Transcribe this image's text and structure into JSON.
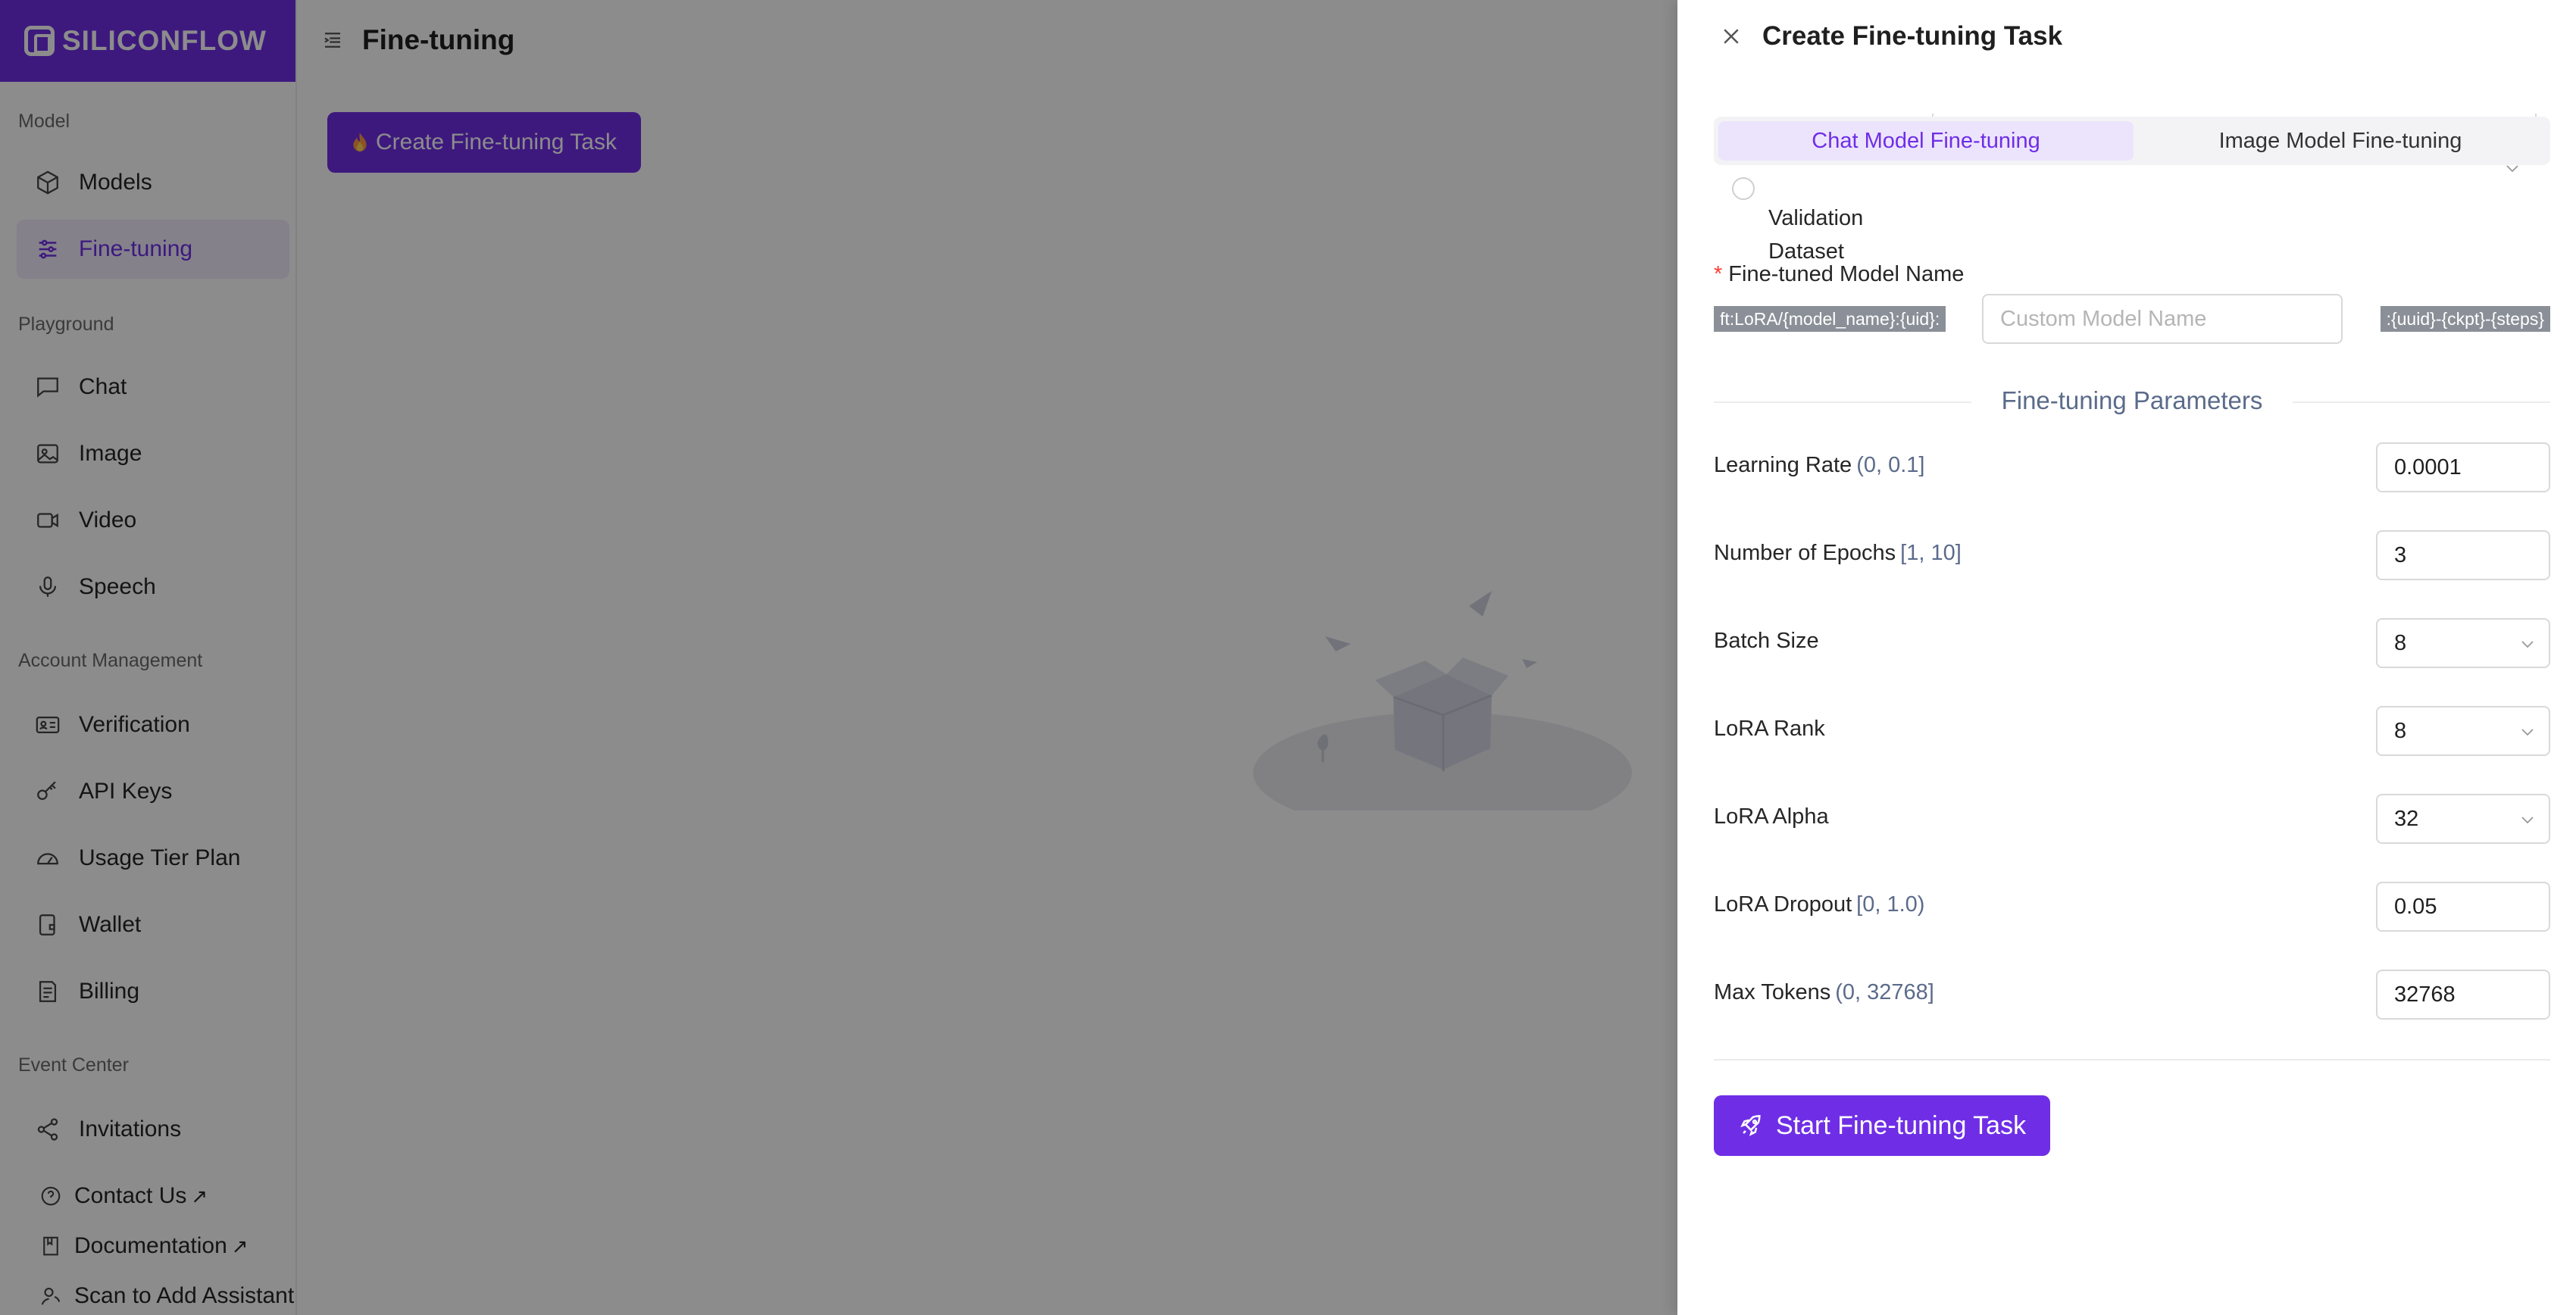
{
  "brand": {
    "name": "SILICONFLOW",
    "color": "#6f2ee6"
  },
  "sidebar": {
    "sections": [
      {
        "title": "Model",
        "items": [
          {
            "label": "Models",
            "icon": "cube-icon"
          },
          {
            "label": "Fine-tuning",
            "icon": "sliders-icon",
            "active": true
          }
        ]
      },
      {
        "title": "Playground",
        "items": [
          {
            "label": "Chat",
            "icon": "chat-icon"
          },
          {
            "label": "Image",
            "icon": "image-icon"
          },
          {
            "label": "Video",
            "icon": "video-icon"
          },
          {
            "label": "Speech",
            "icon": "microphone-icon"
          }
        ]
      },
      {
        "title": "Account Management",
        "items": [
          {
            "label": "Verification",
            "icon": "id-card-icon"
          },
          {
            "label": "API Keys",
            "icon": "key-icon"
          },
          {
            "label": "Usage Tier Plan",
            "icon": "speedometer-icon"
          },
          {
            "label": "Wallet",
            "icon": "wallet-icon"
          },
          {
            "label": "Billing",
            "icon": "bill-icon"
          }
        ]
      },
      {
        "title": "Event Center",
        "items": [
          {
            "label": "Invitations",
            "icon": "share-icon"
          }
        ]
      }
    ],
    "footer_links": [
      {
        "label": "Contact Us",
        "icon": "help-circle-icon",
        "external": "↗"
      },
      {
        "label": "Documentation",
        "icon": "book-icon",
        "external": "↗"
      },
      {
        "label": "Scan to Add Assistant",
        "icon": "user-icon"
      }
    ]
  },
  "main": {
    "title": "Fine-tuning",
    "create_button": "Create Fine-tuning Task"
  },
  "drawer": {
    "title": "Create Fine-tuning Task",
    "tabs": [
      {
        "label": "Chat Model Fine-tuning",
        "active": true
      },
      {
        "label": "Image Model Fine-tuning",
        "active": false
      }
    ],
    "validation_label": "Validation Dataset",
    "model_name": {
      "label": "Fine-tuned Model Name",
      "required_mark": "*",
      "prefix": "ft:LoRA/{model_name}:{uid}:",
      "placeholder": "Custom Model Name",
      "suffix": ":{uuid}-{ckpt}-{steps}"
    },
    "params_title": "Fine-tuning Parameters",
    "params": [
      {
        "label": "Learning Rate",
        "range": "(0, 0.1]",
        "value": "0.0001",
        "kind": "input"
      },
      {
        "label": "Number of Epochs",
        "range": "[1, 10]",
        "value": "3",
        "kind": "input"
      },
      {
        "label": "Batch Size",
        "range": "",
        "value": "8",
        "kind": "select"
      },
      {
        "label": "LoRA Rank",
        "range": "",
        "value": "8",
        "kind": "select"
      },
      {
        "label": "LoRA Alpha",
        "range": "",
        "value": "32",
        "kind": "select"
      },
      {
        "label": "LoRA Dropout",
        "range": "[0, 1.0)",
        "value": "0.05",
        "kind": "input"
      },
      {
        "label": "Max Tokens",
        "range": "(0, 32768]",
        "value": "32768",
        "kind": "input"
      }
    ],
    "start_button": "Start Fine-tuning Task"
  }
}
